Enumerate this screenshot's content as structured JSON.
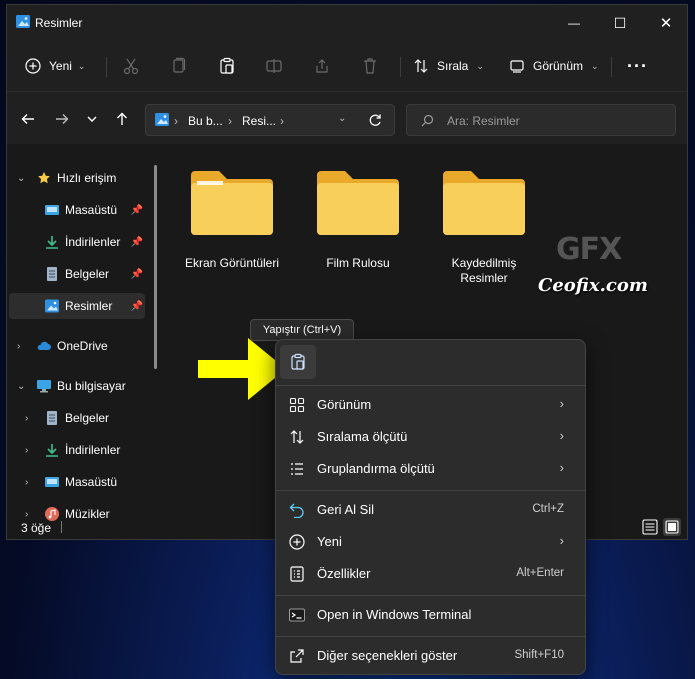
{
  "window": {
    "title": "Resimler"
  },
  "window_controls": {
    "minimize": "—",
    "maximize": "☐",
    "close": "✕"
  },
  "toolbar": {
    "new_label": "Yeni",
    "sort_label": "Sırala",
    "view_label": "Görünüm",
    "more": "···"
  },
  "address": {
    "crumbs": [
      "Bu b...",
      "Resi..."
    ],
    "search_placeholder": "Ara: Resimler"
  },
  "sidebar": {
    "items": [
      {
        "label": "Hızlı erişim"
      },
      {
        "label": "Masaüstü"
      },
      {
        "label": "İndirilenler"
      },
      {
        "label": "Belgeler"
      },
      {
        "label": "Resimler"
      },
      {
        "label": "OneDrive"
      },
      {
        "label": "Bu bilgisayar"
      },
      {
        "label": "Belgeler"
      },
      {
        "label": "İndirilenler"
      },
      {
        "label": "Masaüstü"
      },
      {
        "label": "Müzikler"
      }
    ]
  },
  "folders": [
    {
      "name": "Ekran Görüntüleri"
    },
    {
      "name": "Film Rulosu"
    },
    {
      "name": "Kaydedilmiş Resimler"
    }
  ],
  "status": {
    "count": "3 öğe"
  },
  "tooltip": {
    "text": "Yapıştır (Ctrl+V)"
  },
  "context_menu": {
    "items": [
      {
        "label": "Görünüm"
      },
      {
        "label": "Sıralama ölçütü"
      },
      {
        "label": "Gruplandırma ölçütü"
      },
      {
        "label": "Geri Al Sil",
        "shortcut": "Ctrl+Z"
      },
      {
        "label": "Yeni"
      },
      {
        "label": "Özellikler",
        "shortcut": "Alt+Enter"
      },
      {
        "label": "Open in Windows Terminal"
      },
      {
        "label": "Diğer seçenekleri göster",
        "shortcut": "Shift+F10"
      }
    ]
  },
  "watermark": {
    "logo": "GFX",
    "text": "Ceofix.com"
  },
  "colors": {
    "accent": "#60cdff",
    "folder": "#f7c948",
    "arrow": "#ffff00",
    "background": "#191919"
  }
}
